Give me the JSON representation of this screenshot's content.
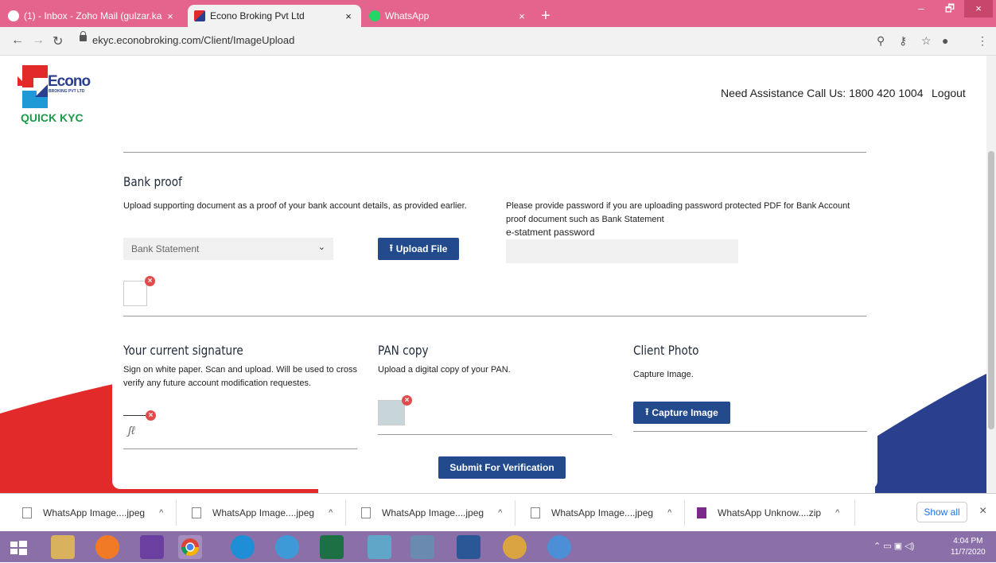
{
  "browser": {
    "tabs": [
      {
        "title": "(1) - Inbox - Zoho Mail (gulzar.ka",
        "close": "×"
      },
      {
        "title": "Econo Broking Pvt Ltd",
        "close": "×"
      },
      {
        "title": "WhatsApp",
        "close": "×"
      }
    ],
    "new_tab": "+",
    "window_buttons": {
      "minimize": "–",
      "restore": "🗗",
      "close": "×"
    },
    "url": "ekyc.econobroking.com/Client/ImageUpload"
  },
  "header": {
    "logo_text": "Econo",
    "logo_subtext": "BROKING PVT LTD",
    "quick_kyc": "QUICK KYC",
    "assistance": "Need Assistance Call Us: 1800 420 1004",
    "logout": "Logout"
  },
  "bank_proof": {
    "heading": "Bank proof",
    "description": "Upload supporting document as a proof of your bank account details, as provided earlier.",
    "select_value": "Bank Statement",
    "upload_button": "Upload File",
    "password_note": "Please provide password if you are uploading password protected PDF for Bank Account proof document such as Bank Statement",
    "password_label": "e-statment password"
  },
  "signature": {
    "heading": "Your current signature",
    "description": "Sign on white paper. Scan and upload. Will be used to cross verify any future account modification requestes."
  },
  "pan": {
    "heading": "PAN copy",
    "description": "Upload a digital copy of your PAN."
  },
  "client_photo": {
    "heading": "Client Photo",
    "description": "Capture Image.",
    "button": "Capture Image"
  },
  "submit_button": "Submit For Verification",
  "downloads": {
    "items": [
      "WhatsApp Image....jpeg",
      "WhatsApp Image....jpeg",
      "WhatsApp Image....jpeg",
      "WhatsApp Image....jpeg",
      "WhatsApp Unknow....zip"
    ],
    "show_all": "Show all",
    "close": "×"
  },
  "taskbar": {
    "time": "4:04 PM",
    "date": "11/7/2020"
  },
  "colors": {
    "tabbar": "#e4648d",
    "primary_button": "#234a8c",
    "brand_red": "#e22a2a",
    "brand_blue": "#2b3f8f",
    "brand_green": "#1a9a4a"
  }
}
